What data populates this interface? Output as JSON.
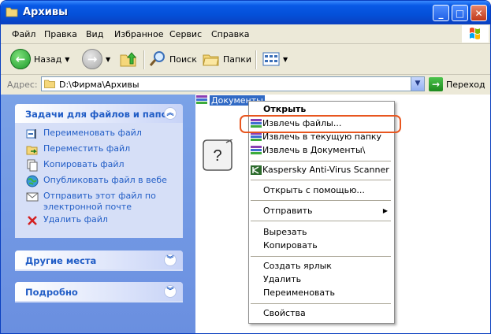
{
  "window": {
    "title": "Архивы"
  },
  "menu": [
    "Файл",
    "Правка",
    "Вид",
    "Избранное",
    "Сервис",
    "Справка"
  ],
  "toolbar": {
    "back": "Назад",
    "search": "Поиск",
    "folders": "Папки"
  },
  "address": {
    "label": "Адрес:",
    "path": "D:\\Фирма\\Архивы",
    "go": "Переход"
  },
  "tasks": {
    "title": "Задачи для файлов и папок",
    "items": [
      "Переименовать файл",
      "Переместить файл",
      "Копировать файл",
      "Опубликовать файл в вебе",
      "Отправить этот файл по электронной почте",
      "Удалить файл"
    ]
  },
  "other_places": {
    "title": "Другие места"
  },
  "details": {
    "title": "Подробно"
  },
  "file": {
    "name": "Документы"
  },
  "context_menu": {
    "open": "Открыть",
    "extract": "Извлечь файлы...",
    "extract_here": "Извлечь в текущую папку",
    "extract_to": "Извлечь в Документы\\",
    "kaspersky": "Kaspersky Anti-Virus Scanner",
    "open_with": "Открыть с помощью...",
    "send_to": "Отправить",
    "cut": "Вырезать",
    "copy": "Копировать",
    "shortcut": "Создать ярлык",
    "delete": "Удалить",
    "rename": "Переименовать",
    "properties": "Свойства"
  },
  "callout": {
    "text": "?"
  },
  "colors": {
    "highlight": "#e8561f",
    "selection": "#316ac5",
    "task_link": "#215dc6"
  }
}
